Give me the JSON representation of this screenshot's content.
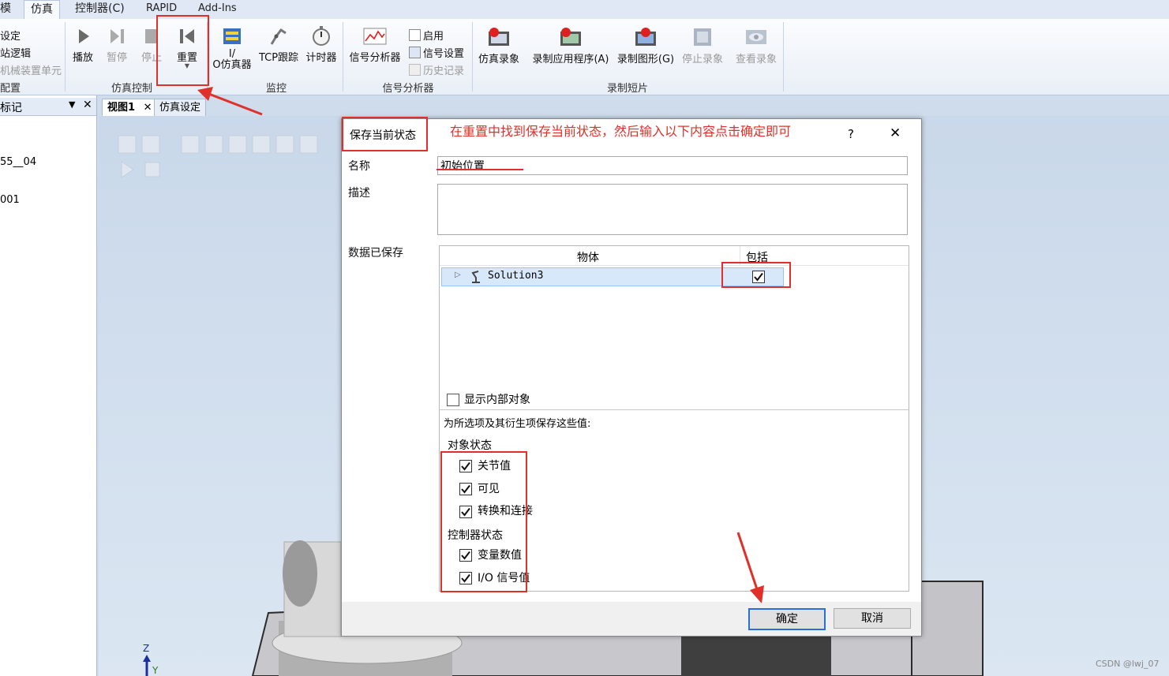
{
  "ribbon_tabs": [
    "模",
    "仿真",
    "控制器(C)",
    "RAPID",
    "Add-Ins"
  ],
  "left_ribbon_items": [
    "设定",
    "站逻辑",
    "机械装置单元",
    "配置"
  ],
  "groups": {
    "sim_control": {
      "label": "仿真控制",
      "play": "播放",
      "pause": "暂停",
      "stop": "停止",
      "reset": "重置"
    },
    "monitor": {
      "label": "监控",
      "io_sim": "I/\nO仿真器",
      "tcp_trace": "TCP跟踪",
      "timer": "计时器"
    },
    "signal_analyzer": {
      "label": "信号分析器",
      "analyzer": "信号分析器",
      "enable": "启用",
      "signal_settings": "信号设置",
      "history": "历史记录"
    },
    "recording": {
      "label": "录制短片",
      "sim_record": "仿真录象",
      "record_app": "录制应用程序(A)",
      "record_graphics": "录制图形(G)",
      "stop_record": "停止录象",
      "view_record": "查看录象"
    }
  },
  "left_panel": {
    "header": "标记",
    "items": [
      "55__04",
      "001"
    ]
  },
  "doc_tabs": [
    "视图1",
    "仿真设定"
  ],
  "annotation": "在重置中找到保存当前状态，然后输入以下内容点击确定即可",
  "dialog": {
    "title": "保存当前状态",
    "help": "?",
    "close": "✕",
    "name_label": "名称",
    "name_value": "初始位置",
    "desc_label": "描述",
    "desc_value": "",
    "saved_label": "数据已保存",
    "col_object": "物体",
    "col_include": "包括",
    "tree_item": "Solution3",
    "show_internal": "显示内部对象",
    "save_hint": "为所选项及其衍生项保存这些值:",
    "object_state": "对象状态",
    "opt_joint": "关节值",
    "opt_visible": "可见",
    "opt_attach": "转换和连接",
    "controller_state": "控制器状态",
    "opt_var": "变量数值",
    "opt_io": "I/O 信号值",
    "ok": "确定",
    "cancel": "取消"
  },
  "axis_z": "Z",
  "axis_y": "Y",
  "watermark": "CSDN @lwj_07"
}
